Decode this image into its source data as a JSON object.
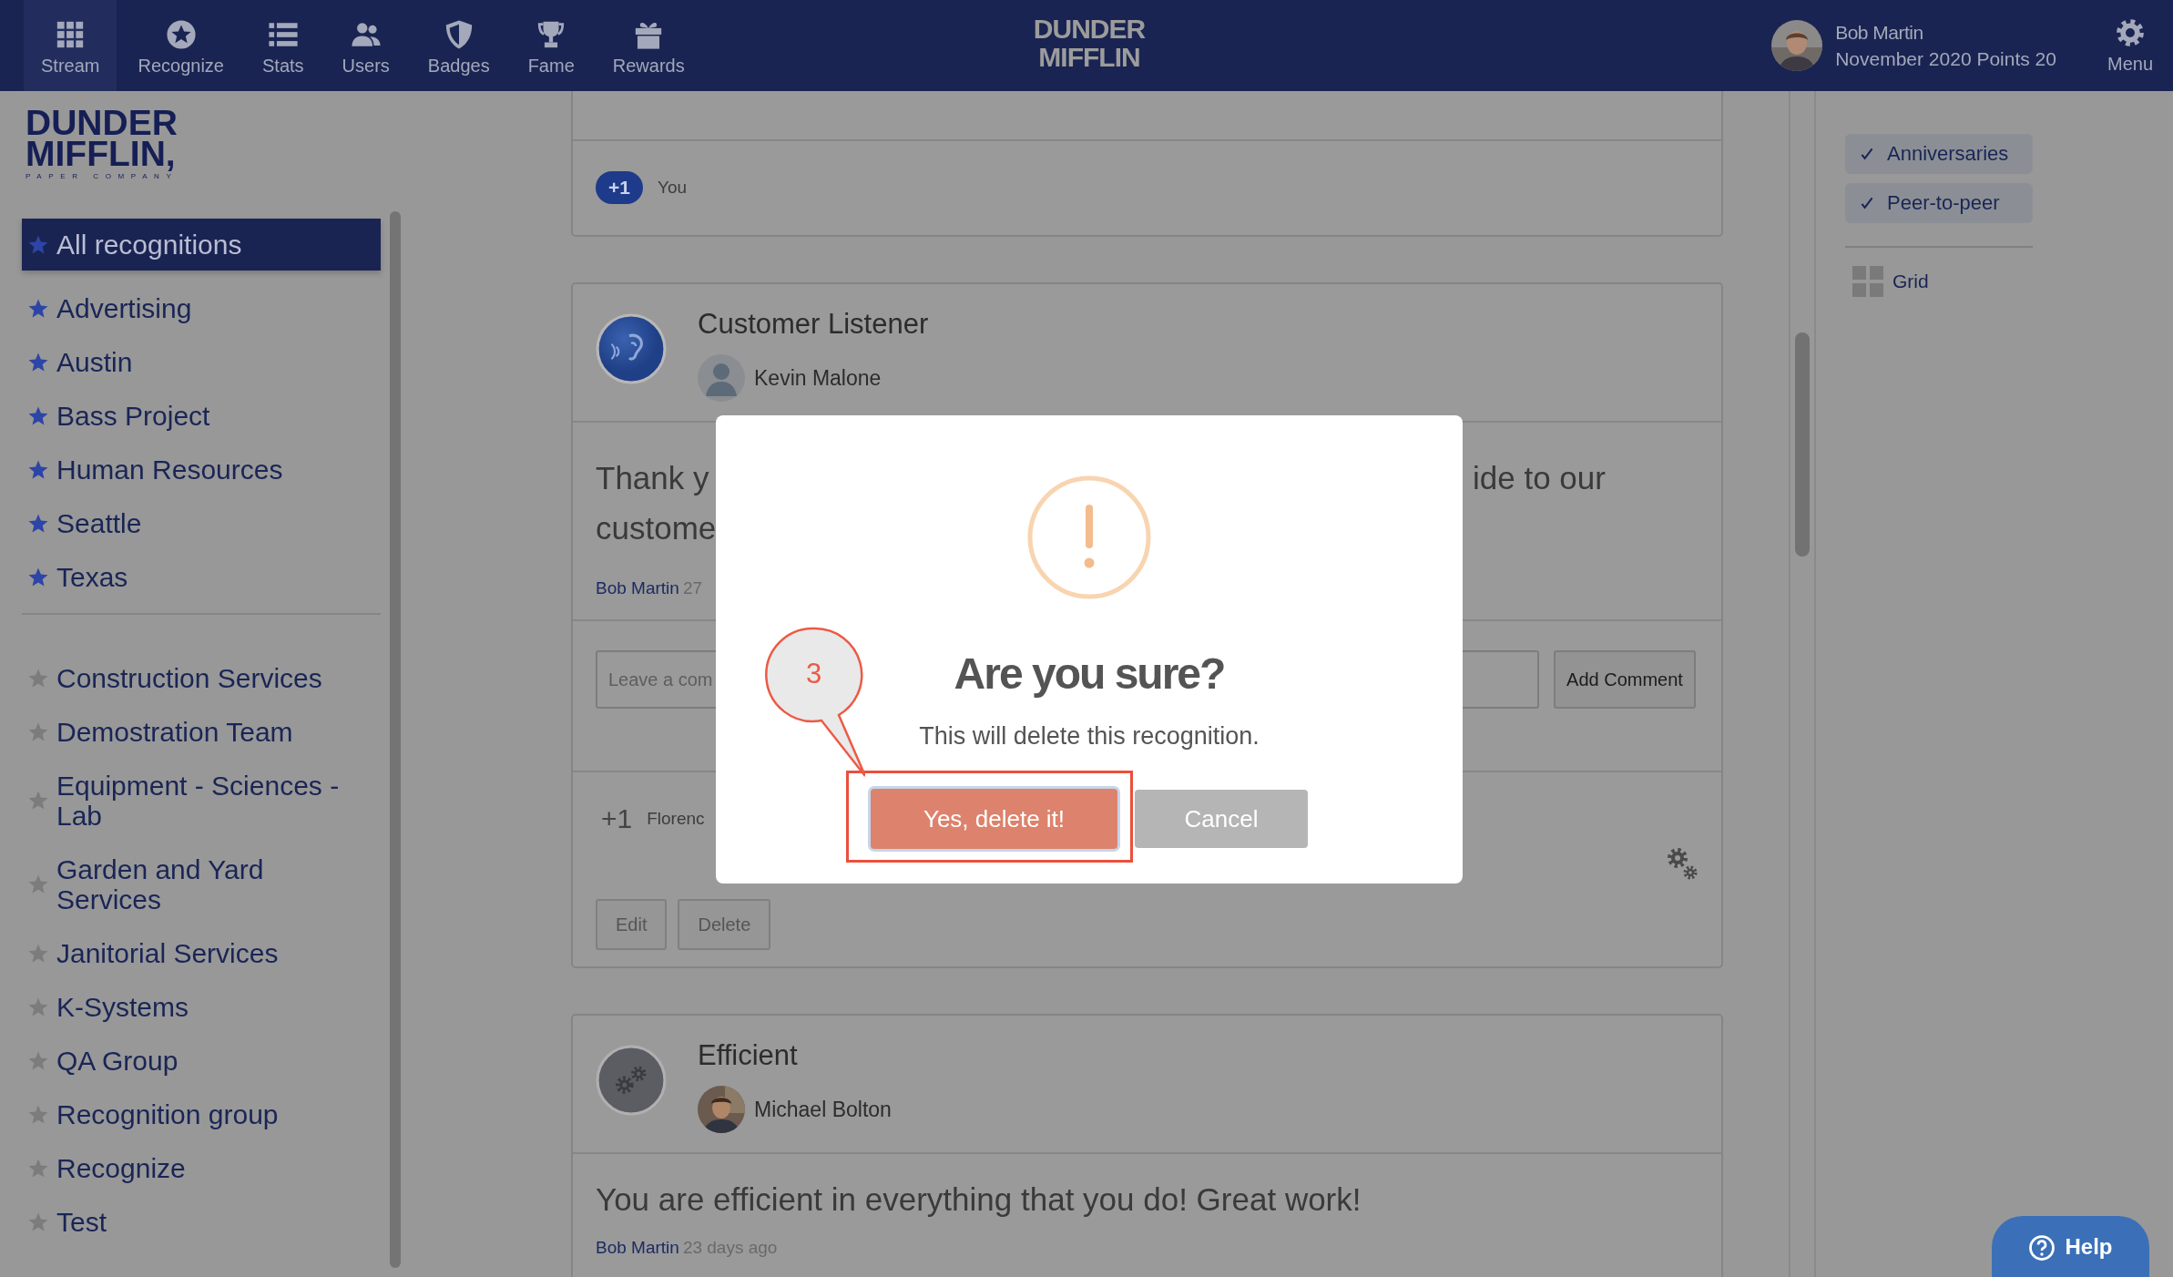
{
  "nav": {
    "items": [
      {
        "label": "Stream",
        "selected": true
      },
      {
        "label": "Recognize",
        "selected": false
      },
      {
        "label": "Stats",
        "selected": false
      },
      {
        "label": "Users",
        "selected": false
      },
      {
        "label": "Badges",
        "selected": false
      },
      {
        "label": "Fame",
        "selected": false
      },
      {
        "label": "Rewards",
        "selected": false
      }
    ],
    "logo": [
      "DUNDER",
      "MIFFLIN"
    ],
    "user": {
      "name": "Bob Martin",
      "detail": "November 2020 Points 20"
    },
    "menu": "Menu"
  },
  "sidebar": {
    "logo": {
      "lines": [
        "DUNDER",
        "MIFFLIN,"
      ],
      "tagline": "PAPER COMPANY"
    },
    "groups": [
      {
        "items": [
          {
            "label": "All recognitions",
            "followed": true,
            "selected": true
          },
          {
            "label": "Advertising",
            "followed": true,
            "selected": false
          },
          {
            "label": "Austin",
            "followed": true,
            "selected": false
          },
          {
            "label": "Bass Project",
            "followed": true,
            "selected": false
          },
          {
            "label": "Human Resources",
            "followed": true,
            "selected": false
          },
          {
            "label": "Seattle",
            "followed": true,
            "selected": false
          },
          {
            "label": "Texas",
            "followed": true,
            "selected": false
          }
        ]
      },
      {
        "items": [
          {
            "label": "Construction Services",
            "followed": false,
            "selected": false
          },
          {
            "label": "Demostration Team",
            "followed": false,
            "selected": false
          },
          {
            "label": "Equipment - Sciences - Lab",
            "followed": false,
            "selected": false
          },
          {
            "label": "Garden and Yard Services",
            "followed": false,
            "selected": false
          },
          {
            "label": "Janitorial Services",
            "followed": false,
            "selected": false
          },
          {
            "label": "K-Systems",
            "followed": false,
            "selected": false
          },
          {
            "label": "QA Group",
            "followed": false,
            "selected": false
          },
          {
            "label": "Recognition group",
            "followed": false,
            "selected": false
          },
          {
            "label": "Recognize",
            "followed": false,
            "selected": false
          },
          {
            "label": "Test",
            "followed": false,
            "selected": false
          }
        ]
      }
    ]
  },
  "feed": {
    "cards": [
      {
        "kind": "reactions",
        "reactions": {
          "count": "+1",
          "people": "You",
          "mine": true
        }
      },
      {
        "kind": "recognition",
        "title": "Customer Listener",
        "recipient": "Kevin Malone",
        "avatar": {
          "kind": "default"
        },
        "message_parts": {
          "left": [
            "Thank y",
            "custome"
          ],
          "right": [
            "ide to our"
          ]
        },
        "author": "Bob Martin",
        "time": "27",
        "comment": {
          "placeholder": "Leave a com",
          "button": "Add Comment"
        },
        "reactions": {
          "count": "+1",
          "people": "Florenc",
          "mine": false
        },
        "actions": [
          "Edit",
          "Delete"
        ]
      },
      {
        "kind": "recognition",
        "title": "Efficient",
        "recipient": "Michael Bolton",
        "message_parts": {
          "left": [
            "You are efficient in everything that you do! Great work!"
          ]
        },
        "author": "Bob Martin",
        "time": "23 days ago"
      }
    ]
  },
  "filters": {
    "items": [
      {
        "label": "Anniversaries",
        "checked": true
      },
      {
        "label": "Peer-to-peer",
        "checked": true
      }
    ],
    "view": "Grid"
  },
  "dialog": {
    "title": "Are you sure?",
    "text": "This will delete this recognition.",
    "confirm": "Yes, delete it!",
    "cancel": "Cancel",
    "annotation": "3"
  },
  "help": "Help"
}
